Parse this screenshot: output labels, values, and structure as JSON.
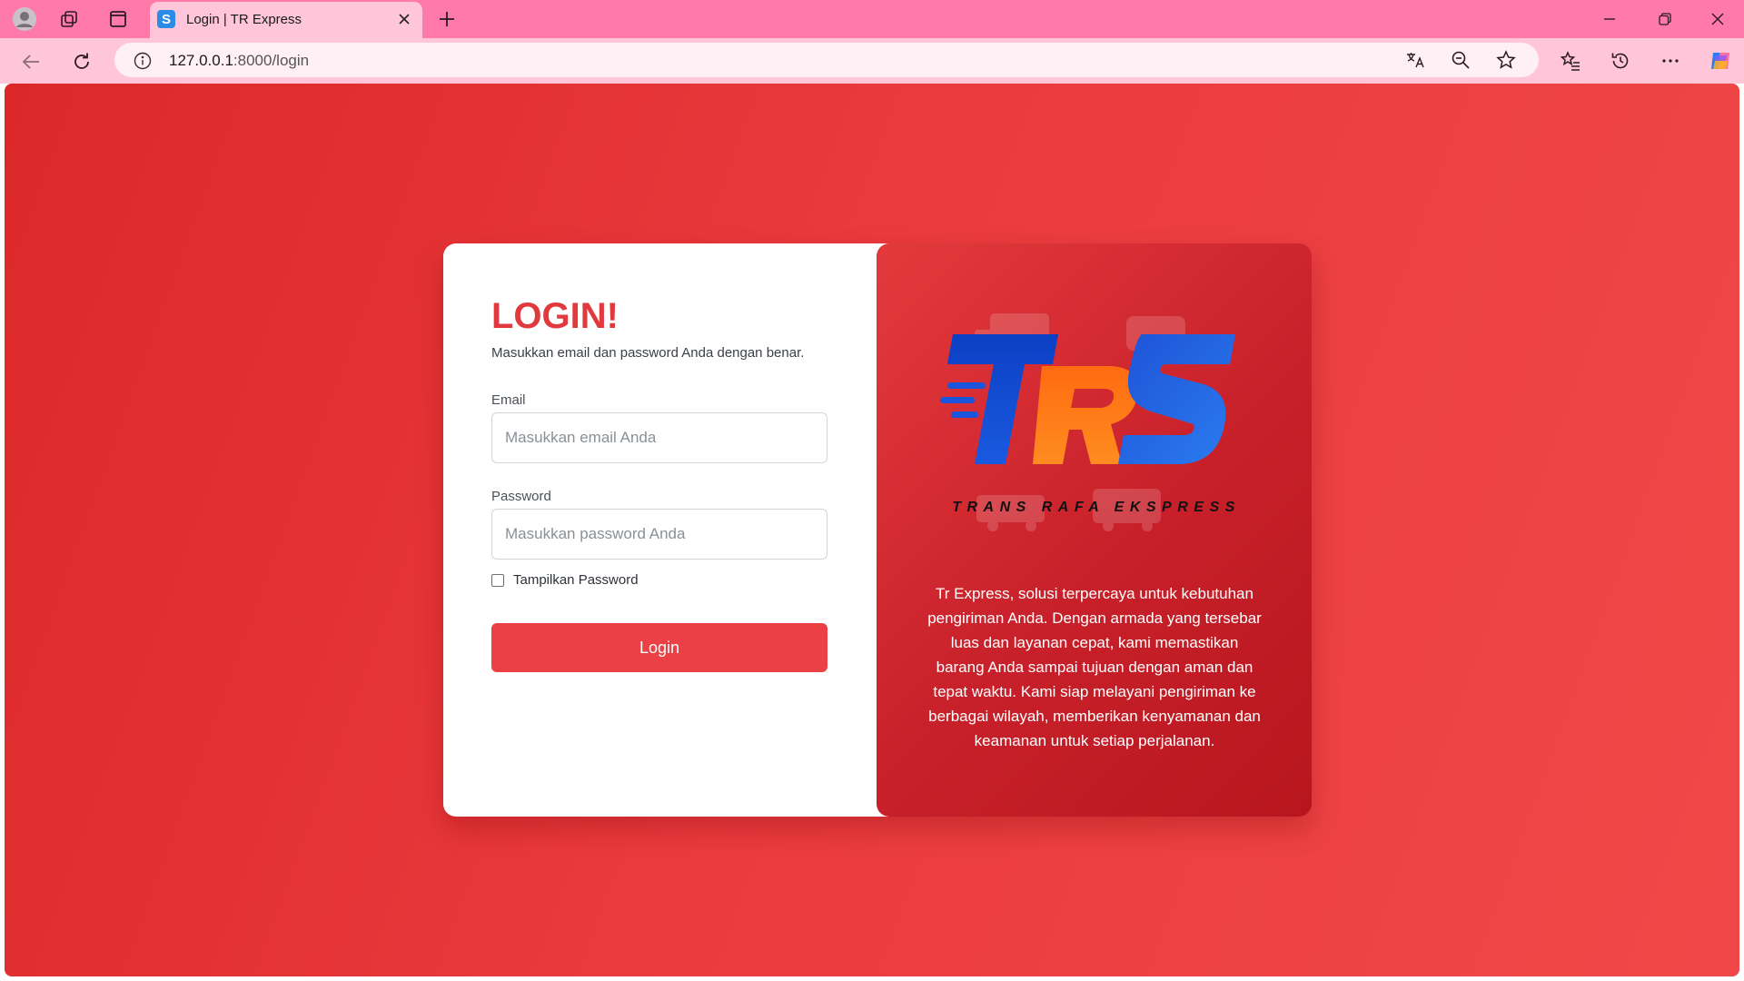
{
  "browser": {
    "tab_title": "Login | TR Express",
    "tab_favicon_letter": "S",
    "url_host": "127.0.0.1",
    "url_path": ":8000/login"
  },
  "login": {
    "title": "LOGIN!",
    "subtitle": "Masukkan email dan password Anda dengan benar.",
    "email_label": "Email",
    "email_placeholder": "Masukkan email Anda",
    "password_label": "Password",
    "password_placeholder": "Masukkan password Anda",
    "show_password_label": "Tampilkan Password",
    "button_label": "Login"
  },
  "brand": {
    "logo_text": "TRS",
    "logo_tagline": "TRANS RAFA EKSPRESS",
    "description": "Tr Express, solusi terpercaya untuk kebutuhan pengiriman Anda. Dengan armada yang tersebar luas dan layanan cepat, kami memastikan barang Anda sampai tujuan dengan aman dan tepat waktu. Kami siap melayani pengiriman ke berbagai wilayah, memberikan kenyamanan dan keamanan untuk setiap perjalanan."
  },
  "colors": {
    "tabbar": "#ff7aa8",
    "page_bg": "#e63a3c",
    "accent": "#e03a3e",
    "button": "#ea4046",
    "logo_blue": "#1546c8",
    "logo_orange": "#ff7a12"
  }
}
